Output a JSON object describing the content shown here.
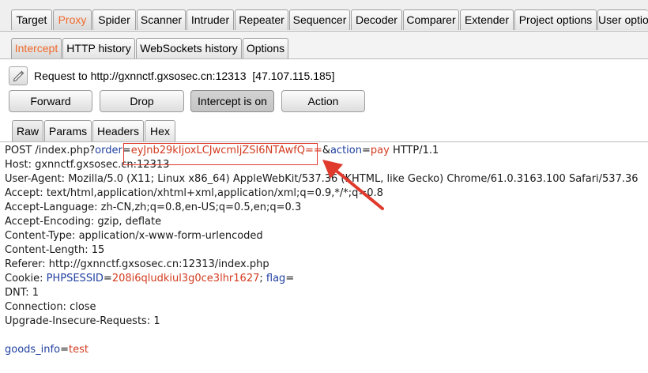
{
  "main_tabs": [
    "Target",
    "Proxy",
    "Spider",
    "Scanner",
    "Intruder",
    "Repeater",
    "Sequencer",
    "Decoder",
    "Comparer",
    "Extender",
    "Project options",
    "User optio"
  ],
  "sub_tabs": [
    "Intercept",
    "HTTP history",
    "WebSockets history",
    "Options"
  ],
  "request": {
    "label": "Request to http://gxnnctf.gxsosec.cn:12313",
    "ip": "[47.107.115.185]"
  },
  "buttons": {
    "forward": "Forward",
    "drop": "Drop",
    "intercept": "Intercept is on",
    "action": "Action"
  },
  "view_tabs": [
    "Raw",
    "Params",
    "Headers",
    "Hex"
  ],
  "raw": {
    "request_line": {
      "method_path": "POST /index.php?",
      "p1_name": "order",
      "eq1": "=",
      "p1_value": "eyJnb29kIjoxLCJwcmljZSI6NTAwfQ==",
      "amp": "&",
      "p2_name": "action",
      "eq2": "=",
      "p2_value": "pay",
      "protocol": " HTTP/1.1"
    },
    "headers": [
      "Host: gxnnctf.gxsosec.cn:12313",
      "User-Agent: Mozilla/5.0 (X11; Linux x86_64) AppleWebKit/537.36 (KHTML, like Gecko) Chrome/61.0.3163.100 Safari/537.36",
      "Accept: text/html,application/xhtml+xml,application/xml;q=0.9,*/*;q=0.8",
      "Accept-Language: zh-CN,zh;q=0.8,en-US;q=0.5,en;q=0.3",
      "Accept-Encoding: gzip, deflate",
      "Content-Type: application/x-www-form-urlencoded",
      "Content-Length: 15",
      "Referer: http://gxnnctf.gxsosec.cn:12313/index.php"
    ],
    "cookie": {
      "prefix": "Cookie: ",
      "name1": "PHPSESSID",
      "eq1": "=",
      "value1": "208i6qludkiul3g0ce3lhr1627",
      "sep": "; ",
      "name2": "flag",
      "eq2": "="
    },
    "tail_headers": [
      "DNT: 1",
      "Connection: close",
      "Upgrade-Insecure-Requests: 1"
    ],
    "body": {
      "name": "goods_info",
      "eq": "=",
      "value": "test"
    }
  },
  "colors": {
    "active_tab": "#f06a2b",
    "param_name": "#1f3f9f",
    "param_value": "#d23b1f",
    "annotation": "#e03a2d"
  }
}
